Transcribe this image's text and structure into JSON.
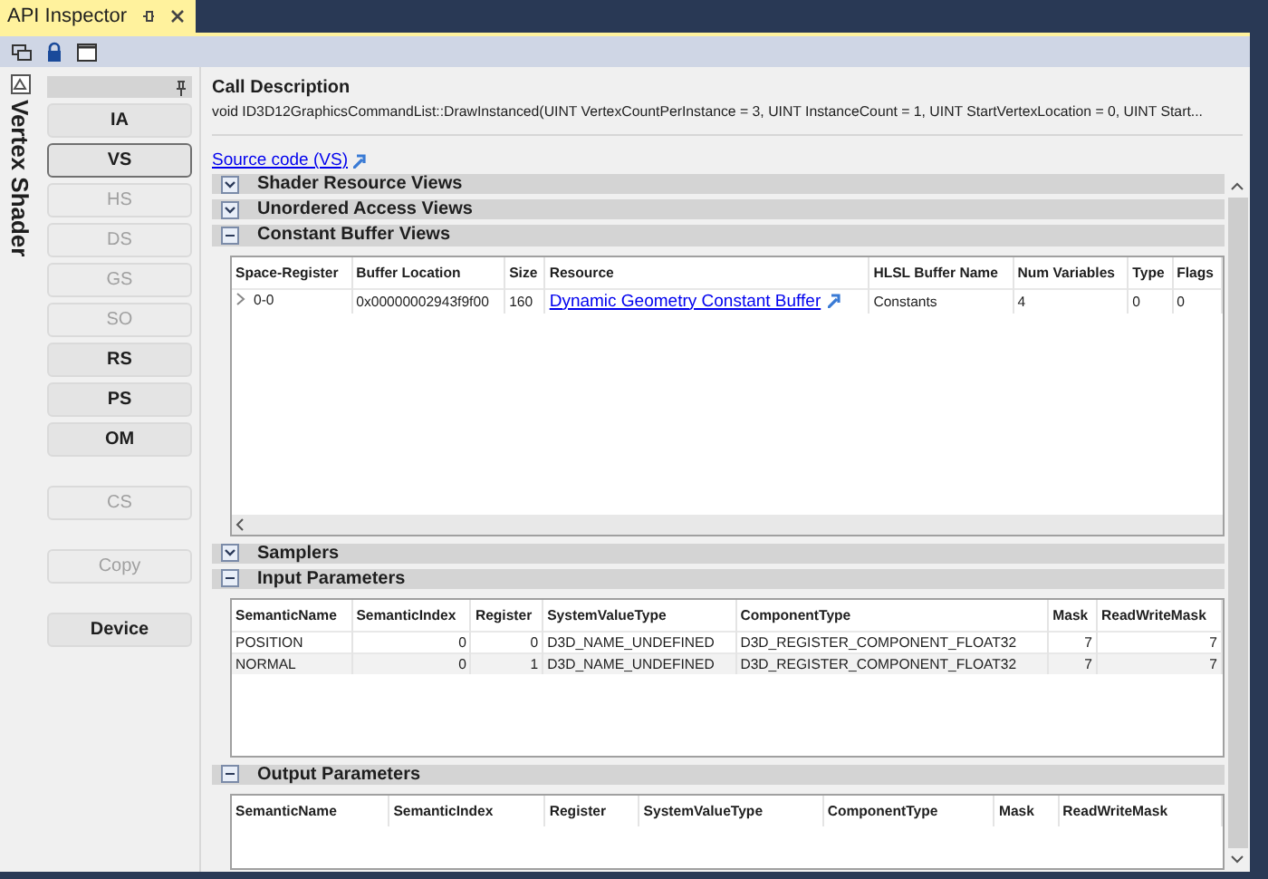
{
  "window": {
    "title": "API Inspector"
  },
  "side_title": "Vertex Shader",
  "button_groups": [
    [
      {
        "label": "IA",
        "selected": false,
        "disabled": false
      },
      {
        "label": "VS",
        "selected": true,
        "disabled": false
      },
      {
        "label": "HS",
        "selected": false,
        "disabled": true
      },
      {
        "label": "DS",
        "selected": false,
        "disabled": true
      },
      {
        "label": "GS",
        "selected": false,
        "disabled": true
      },
      {
        "label": "SO",
        "selected": false,
        "disabled": true
      },
      {
        "label": "RS",
        "selected": false,
        "disabled": false
      },
      {
        "label": "PS",
        "selected": false,
        "disabled": false
      },
      {
        "label": "OM",
        "selected": false,
        "disabled": false
      }
    ],
    [
      {
        "label": "CS",
        "selected": false,
        "disabled": true
      }
    ],
    [
      {
        "label": "Copy",
        "selected": false,
        "disabled": true
      }
    ],
    [
      {
        "label": "Device",
        "selected": false,
        "disabled": false
      }
    ]
  ],
  "call_description": {
    "title": "Call Description",
    "text": "void ID3D12GraphicsCommandList::DrawInstanced(UINT VertexCountPerInstance = 3, UINT InstanceCount = 1, UINT StartVertexLocation = 0, UINT Start..."
  },
  "source_link": "Source code (VS)",
  "sections": [
    {
      "title": "Shader Resource Views",
      "expanded": false
    },
    {
      "title": "Unordered Access Views",
      "expanded": false
    },
    {
      "title": "Constant Buffer Views",
      "expanded": true,
      "table": {
        "columns": [
          {
            "label": "Space-Register",
            "kind": "text"
          },
          {
            "label": "Buffer Location",
            "kind": "text"
          },
          {
            "label": "Size",
            "kind": "text"
          },
          {
            "label": "Resource",
            "kind": "link"
          },
          {
            "label": "HLSL Buffer Name",
            "kind": "text"
          },
          {
            "label": "Num Variables",
            "kind": "text"
          },
          {
            "label": "Type",
            "kind": "text"
          },
          {
            "label": "Flags",
            "kind": "text"
          }
        ],
        "rows": [
          {
            "expandable": true,
            "cells": [
              "0-0",
              "0x00000002943f9f00",
              "160",
              "Dynamic Geometry Constant Buffer",
              "Constants",
              "4",
              "0",
              "0"
            ]
          }
        ]
      }
    },
    {
      "title": "Samplers",
      "expanded": false
    },
    {
      "title": "Input Parameters",
      "expanded": true,
      "table": {
        "columns": [
          {
            "label": "SemanticName",
            "kind": "text"
          },
          {
            "label": "SemanticIndex",
            "kind": "number"
          },
          {
            "label": "Register",
            "kind": "number"
          },
          {
            "label": "SystemValueType",
            "kind": "text"
          },
          {
            "label": "ComponentType",
            "kind": "text"
          },
          {
            "label": "Mask",
            "kind": "number"
          },
          {
            "label": "ReadWriteMask",
            "kind": "number"
          }
        ],
        "rows": [
          {
            "expandable": false,
            "cells": [
              "POSITION",
              "0",
              "0",
              "D3D_NAME_UNDEFINED",
              "D3D_REGISTER_COMPONENT_FLOAT32",
              "7",
              "7"
            ]
          },
          {
            "expandable": false,
            "cells": [
              "NORMAL",
              "0",
              "1",
              "D3D_NAME_UNDEFINED",
              "D3D_REGISTER_COMPONENT_FLOAT32",
              "7",
              "7"
            ]
          }
        ]
      }
    },
    {
      "title": "Output Parameters",
      "expanded": true,
      "table": {
        "columns": [
          {
            "label": "SemanticName"
          },
          {
            "label": "SemanticIndex"
          },
          {
            "label": "Register"
          },
          {
            "label": "SystemValueType"
          },
          {
            "label": "ComponentType"
          },
          {
            "label": "Mask"
          },
          {
            "label": "ReadWriteMask"
          }
        ]
      }
    }
  ]
}
